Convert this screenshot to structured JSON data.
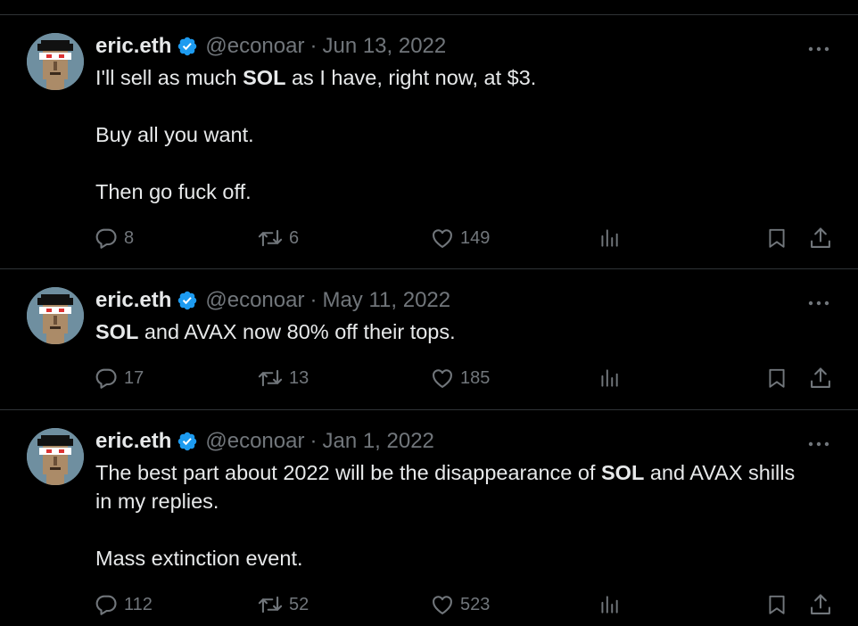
{
  "tweets": [
    {
      "name": "eric.eth",
      "handle": "@econoar",
      "separator": "·",
      "date": "Jun 13, 2022",
      "text_lines": [
        {
          "pre": "I'll sell as much ",
          "bold": "SOL",
          "post": " as I have, right now, at $3."
        },
        {
          "blank": true
        },
        {
          "pre": "Buy all you want.",
          "bold": "",
          "post": ""
        },
        {
          "blank": true
        },
        {
          "pre": "Then go fuck off.",
          "bold": "",
          "post": ""
        }
      ],
      "replies": "8",
      "reposts": "6",
      "likes": "149"
    },
    {
      "name": "eric.eth",
      "handle": "@econoar",
      "separator": "·",
      "date": "May 11, 2022",
      "text_lines": [
        {
          "pre": "",
          "bold": "SOL",
          "post": " and AVAX now 80% off their tops."
        }
      ],
      "replies": "17",
      "reposts": "13",
      "likes": "185"
    },
    {
      "name": "eric.eth",
      "handle": "@econoar",
      "separator": "·",
      "date": "Jan 1, 2022",
      "text_lines": [
        {
          "pre": "The best part about 2022 will be the disappearance of ",
          "bold": "SOL",
          "post": " and AVAX shills"
        },
        {
          "pre": "in my replies.",
          "bold": "",
          "post": ""
        },
        {
          "blank": true
        },
        {
          "pre": "Mass extinction event.",
          "bold": "",
          "post": ""
        }
      ],
      "replies": "112",
      "reposts": "52",
      "likes": "523"
    }
  ],
  "colors": {
    "background": "#000000",
    "text": "#e7e9ea",
    "muted": "#71767b",
    "verified": "#1d9bf0",
    "border": "#2f3336"
  },
  "icons": [
    "verified-badge-icon",
    "more-icon",
    "reply-icon",
    "repost-icon",
    "like-icon",
    "views-icon",
    "bookmark-icon",
    "share-icon"
  ]
}
